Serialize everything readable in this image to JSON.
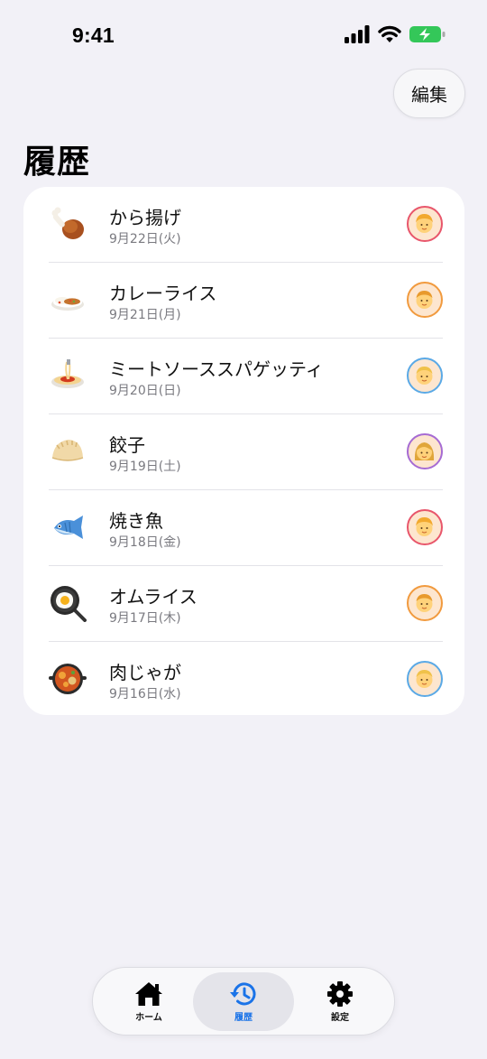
{
  "status_bar": {
    "time": "9:41"
  },
  "header": {
    "edit_label": "編集",
    "title": "履歴"
  },
  "history": [
    {
      "name": "から揚げ",
      "date": "9月22日(火)",
      "food_icon": "fried-chicken-icon",
      "avatar_color": "#e8566b"
    },
    {
      "name": "カレーライス",
      "date": "9月21日(月)",
      "food_icon": "curry-rice-icon",
      "avatar_color": "#f19a3e"
    },
    {
      "name": "ミートソーススパゲッティ",
      "date": "9月20日(日)",
      "food_icon": "spaghetti-icon",
      "avatar_color": "#5aa9e6"
    },
    {
      "name": "餃子",
      "date": "9月19日(土)",
      "food_icon": "dumpling-icon",
      "avatar_color": "#a66bd3"
    },
    {
      "name": "焼き魚",
      "date": "9月18日(金)",
      "food_icon": "fish-icon",
      "avatar_color": "#e8566b"
    },
    {
      "name": "オムライス",
      "date": "9月17日(木)",
      "food_icon": "fried-egg-pan-icon",
      "avatar_color": "#f19a3e"
    },
    {
      "name": "肉じゃが",
      "date": "9月16日(水)",
      "food_icon": "stew-pot-icon",
      "avatar_color": "#5aa9e6"
    }
  ],
  "tab_bar": {
    "tabs": [
      {
        "label": "ホーム",
        "icon": "house-icon",
        "active": false
      },
      {
        "label": "履歴",
        "icon": "history-icon",
        "active": true
      },
      {
        "label": "設定",
        "icon": "gear-icon",
        "active": false
      }
    ],
    "accent_color": "#1a73e8"
  }
}
